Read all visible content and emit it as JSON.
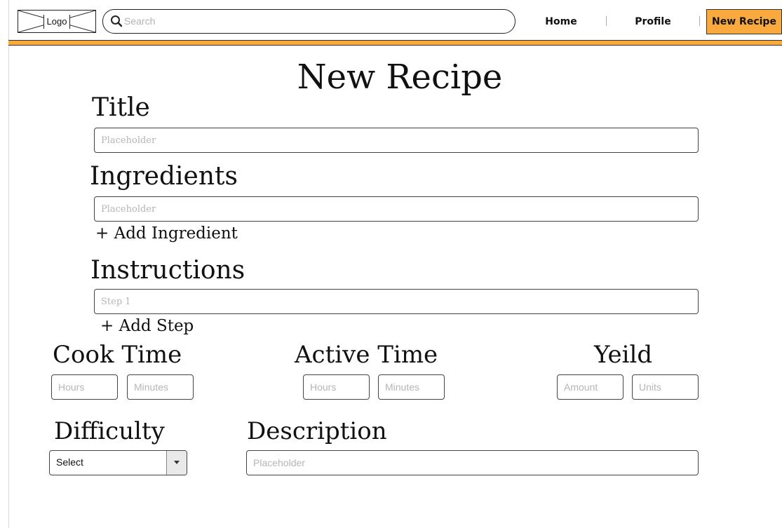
{
  "header": {
    "logo_label": "Logo",
    "search_placeholder": "Search",
    "nav": {
      "home": "Home",
      "profile": "Profile",
      "new_recipe": "New Recipe"
    }
  },
  "page": {
    "title": "New Recipe"
  },
  "form": {
    "title": {
      "label": "Title",
      "placeholder": "Placeholder"
    },
    "ingredients": {
      "label": "Ingredients",
      "placeholder": "Placeholder",
      "add_label": "+ Add Ingredient"
    },
    "instructions": {
      "label": "Instructions",
      "placeholder": "Step 1",
      "add_label": "+ Add Step"
    },
    "cook_time": {
      "label": "Cook Time",
      "hours_placeholder": "Hours",
      "minutes_placeholder": "Minutes"
    },
    "active_time": {
      "label": "Active Time",
      "hours_placeholder": "Hours",
      "minutes_placeholder": "Minutes"
    },
    "yield": {
      "label": "Yeild",
      "amount_placeholder": "Amount",
      "units_placeholder": "Units"
    },
    "difficulty": {
      "label": "Difficulty",
      "selected": "Select"
    },
    "description": {
      "label": "Description",
      "placeholder": "Placeholder"
    }
  },
  "colors": {
    "accent": "#f9a93e",
    "border": "#444444",
    "placeholder": "#b5b5b5"
  },
  "icons": {
    "search": "search-icon",
    "dropdown": "chevron-down-icon"
  }
}
